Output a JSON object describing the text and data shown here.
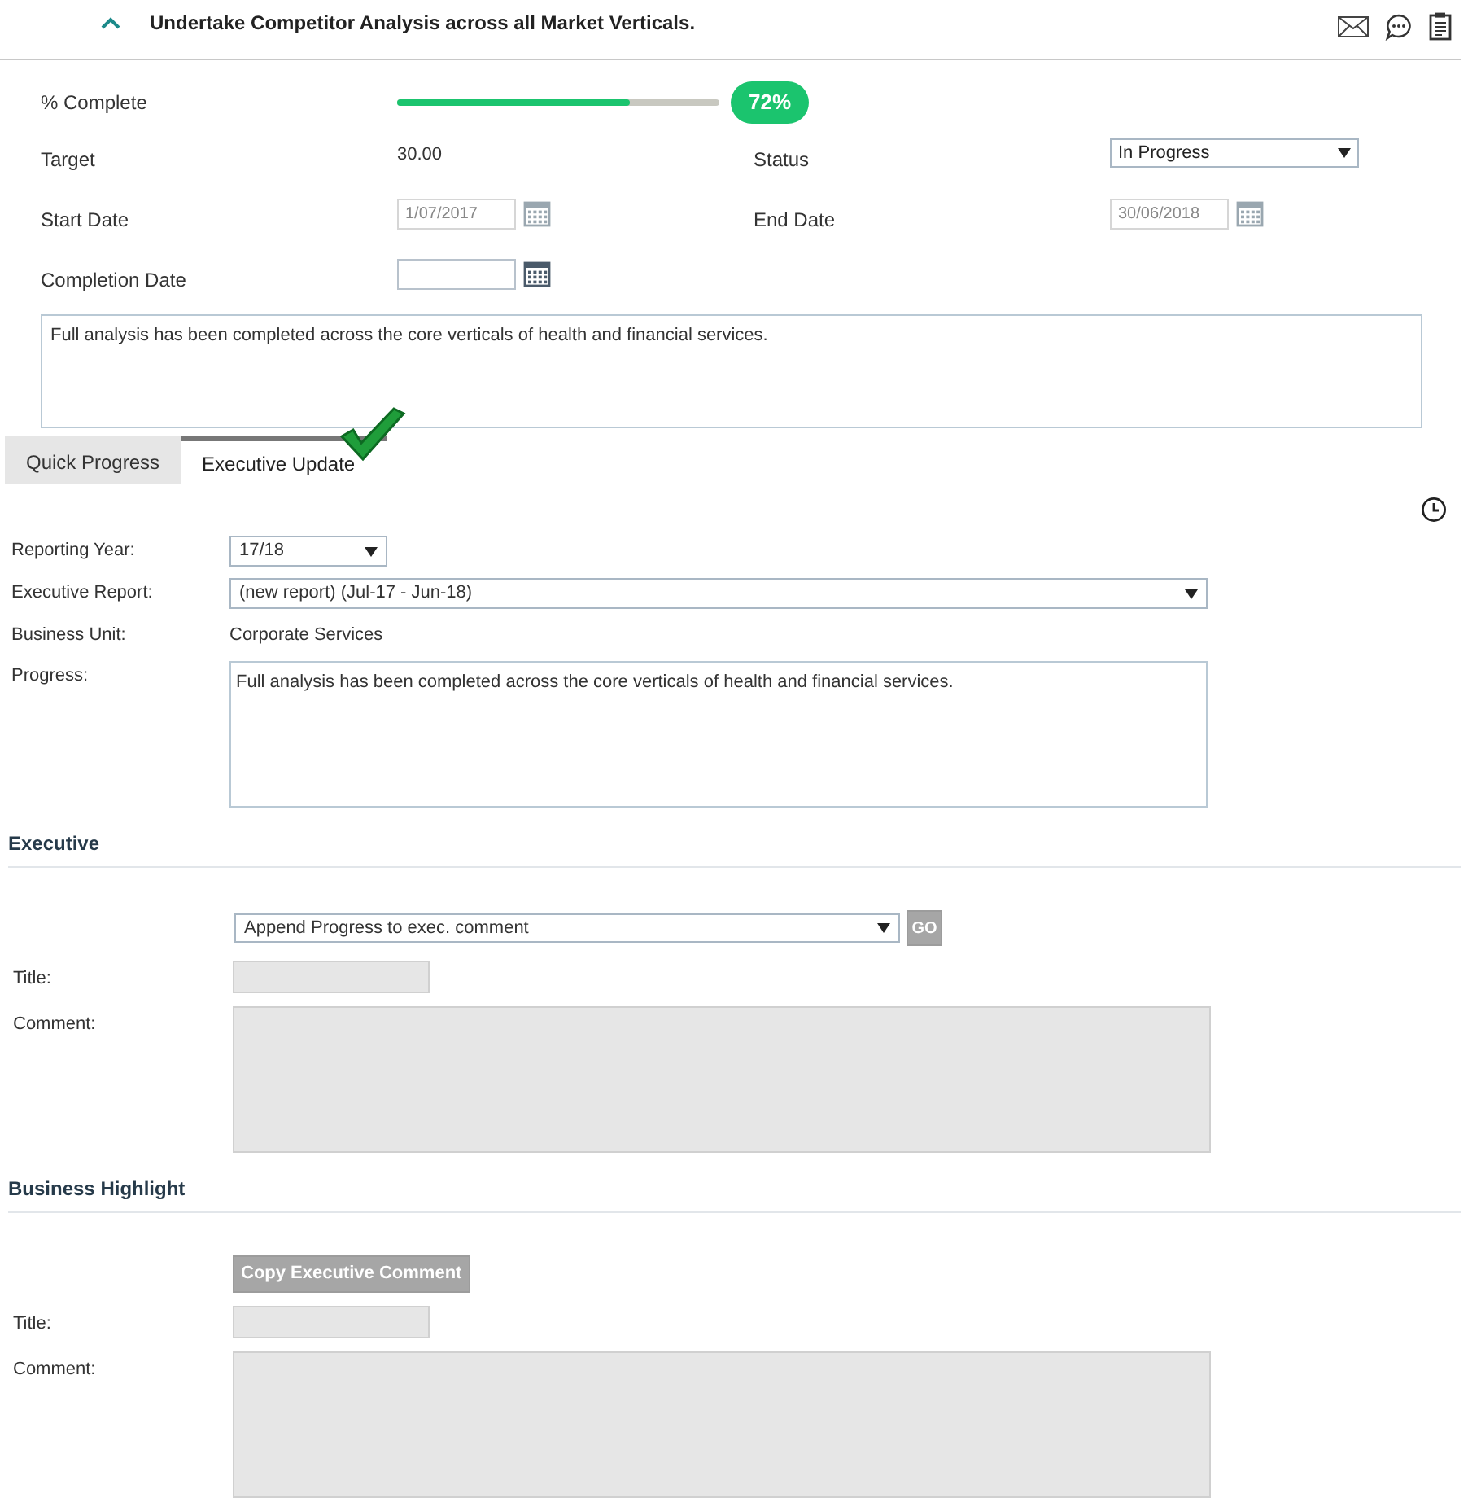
{
  "task": {
    "title": "Undertake Competitor Analysis across all Market Verticals.",
    "expanded": true
  },
  "progress": {
    "label": "% Complete",
    "level": 0.72,
    "reading": "72%"
  },
  "fields": [
    {
      "label": "Target",
      "kind": "text",
      "value": "30.00"
    },
    {
      "label": "Status",
      "kind": "select",
      "value": "In Progress",
      "disabled": false
    },
    {
      "label": "Start Date",
      "kind": "date",
      "value": "1/07/2017",
      "disabled": true
    },
    {
      "label": "End Date",
      "kind": "date",
      "value": "30/06/2018",
      "disabled": true
    },
    {
      "label": "Completion Date",
      "kind": "date",
      "disabled": false
    }
  ],
  "notes": "Full analysis has been completed across the core verticals of health and financial services.",
  "tabs": [
    {
      "label": "Quick Progress",
      "selected": false
    },
    {
      "label": "Executive Update",
      "selected": true,
      "done": true
    }
  ],
  "executive_update": {
    "rows": [
      {
        "label": "Reporting Year:",
        "kind": "select",
        "value": "17/18",
        "wide": false
      },
      {
        "label": "Executive Report:",
        "kind": "select",
        "value": "(new report) (Jul-17 - Jun-18)",
        "wide": true
      },
      {
        "label": "Business Unit:",
        "kind": "text",
        "value": "Corporate Services"
      },
      {
        "label": "Progress:",
        "kind": "textarea",
        "value": "Full analysis has been completed across the core verticals of health and financial services."
      }
    ]
  },
  "sections": [
    {
      "heading": "Executive",
      "kind": "select_go",
      "action": "Append Progress to exec. comment",
      "button": "GO",
      "button_disabled": true,
      "title_label": "Title:",
      "title_disabled": true,
      "comment_label": "Comment:",
      "comment_disabled": true
    },
    {
      "heading": "Business Highlight",
      "kind": "button",
      "button": "Copy Executive Comment",
      "button_disabled": true,
      "title_label": "Title:",
      "title_disabled": true,
      "comment_label": "Comment:",
      "comment_disabled": true
    }
  ]
}
